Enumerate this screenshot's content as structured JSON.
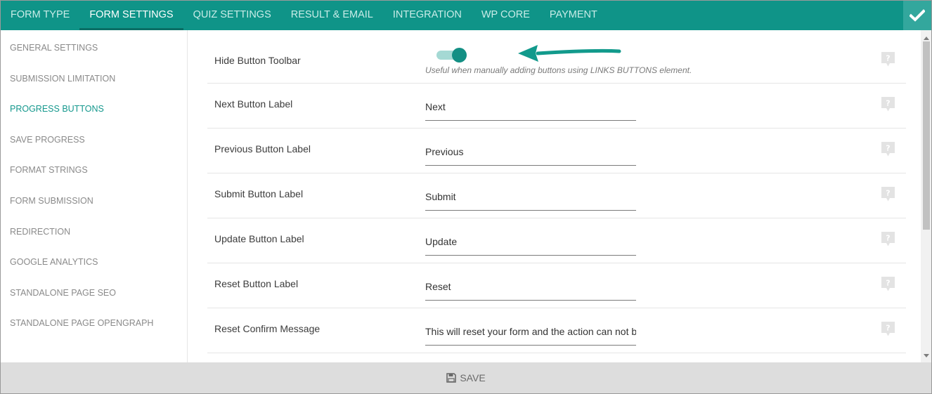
{
  "tabs": [
    {
      "label": "FORM TYPE"
    },
    {
      "label": "FORM SETTINGS"
    },
    {
      "label": "QUIZ SETTINGS"
    },
    {
      "label": "RESULT & EMAIL"
    },
    {
      "label": "INTEGRATION"
    },
    {
      "label": "WP CORE"
    },
    {
      "label": "PAYMENT"
    }
  ],
  "active_tab": "FORM SETTINGS",
  "sidebar": {
    "items": [
      {
        "label": "GENERAL SETTINGS"
      },
      {
        "label": "SUBMISSION LIMITATION"
      },
      {
        "label": "PROGRESS BUTTONS"
      },
      {
        "label": "SAVE PROGRESS"
      },
      {
        "label": "FORMAT STRINGS"
      },
      {
        "label": "FORM SUBMISSION"
      },
      {
        "label": "REDIRECTION"
      },
      {
        "label": "GOOGLE ANALYTICS"
      },
      {
        "label": "STANDALONE PAGE SEO"
      },
      {
        "label": "STANDALONE PAGE OPENGRAPH"
      }
    ],
    "active_item": "PROGRESS BUTTONS"
  },
  "settings": {
    "hide_toolbar": {
      "label": "Hide Button Toolbar",
      "enabled": true,
      "hint": "Useful when manually adding buttons using LINKS BUTTONS element."
    },
    "fields": [
      {
        "label": "Next Button Label",
        "value": "Next"
      },
      {
        "label": "Previous Button Label",
        "value": "Previous"
      },
      {
        "label": "Submit Button Label",
        "value": "Submit"
      },
      {
        "label": "Update Button Label",
        "value": "Update"
      },
      {
        "label": "Reset Button Label",
        "value": "Reset"
      },
      {
        "label": "Reset Confirm Message",
        "value": "This will reset your form and the action can not be undone."
      }
    ]
  },
  "footer": {
    "save_label": "SAVE"
  },
  "colors": {
    "brand": "#0f9488",
    "accent_text": "#14988d",
    "toggle_track": "#a5d9d4",
    "toggle_knob": "#138f84"
  },
  "icons": {
    "confirm": "checkmark-icon",
    "help": "help-icon",
    "save": "floppy-disk-icon",
    "annotation": "arrow-icon"
  }
}
